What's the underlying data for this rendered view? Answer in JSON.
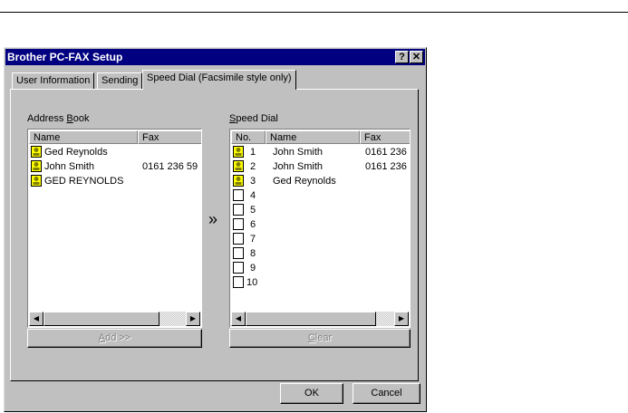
{
  "window": {
    "title": "Brother PC-FAX Setup",
    "help_button": "?",
    "close_button": "✕"
  },
  "tabs": [
    {
      "label": "User Information"
    },
    {
      "label": "Sending"
    },
    {
      "label": "Speed Dial (Facsimile style only)"
    }
  ],
  "address_book": {
    "label_pre": "Address ",
    "label_key": "B",
    "label_post": "ook",
    "columns": [
      "Name",
      "Fax"
    ],
    "rows": [
      {
        "name": "Ged Reynolds",
        "fax": ""
      },
      {
        "name": "John Smith",
        "fax": "0161 236 59"
      },
      {
        "name": "GED REYNOLDS",
        "fax": ""
      }
    ],
    "add_button_key": "A",
    "add_button_rest": "dd >>"
  },
  "transfer_arrow": "»",
  "speed_dial": {
    "label_key": "S",
    "label_rest": "peed Dial",
    "columns": [
      "No.",
      "Name",
      "Fax"
    ],
    "rows": [
      {
        "no": "1",
        "name": "John Smith",
        "fax": "0161 236",
        "filled": true
      },
      {
        "no": "2",
        "name": "John Smith",
        "fax": "0161 236",
        "filled": true
      },
      {
        "no": "3",
        "name": "Ged Reynolds",
        "fax": "",
        "filled": true
      },
      {
        "no": "4",
        "name": "",
        "fax": "",
        "filled": false
      },
      {
        "no": "5",
        "name": "",
        "fax": "",
        "filled": false
      },
      {
        "no": "6",
        "name": "",
        "fax": "",
        "filled": false
      },
      {
        "no": "7",
        "name": "",
        "fax": "",
        "filled": false
      },
      {
        "no": "8",
        "name": "",
        "fax": "",
        "filled": false
      },
      {
        "no": "9",
        "name": "",
        "fax": "",
        "filled": false
      },
      {
        "no": "10",
        "name": "",
        "fax": "",
        "filled": false
      }
    ],
    "clear_button_key": "C",
    "clear_button_rest": "lear"
  },
  "scroll_left": "◀",
  "scroll_right": "▶",
  "ok_label": "OK",
  "cancel_label": "Cancel",
  "colors": {
    "title_bar": "#000080",
    "face": "#c0c0c0",
    "card_icon": "#ffff00"
  }
}
